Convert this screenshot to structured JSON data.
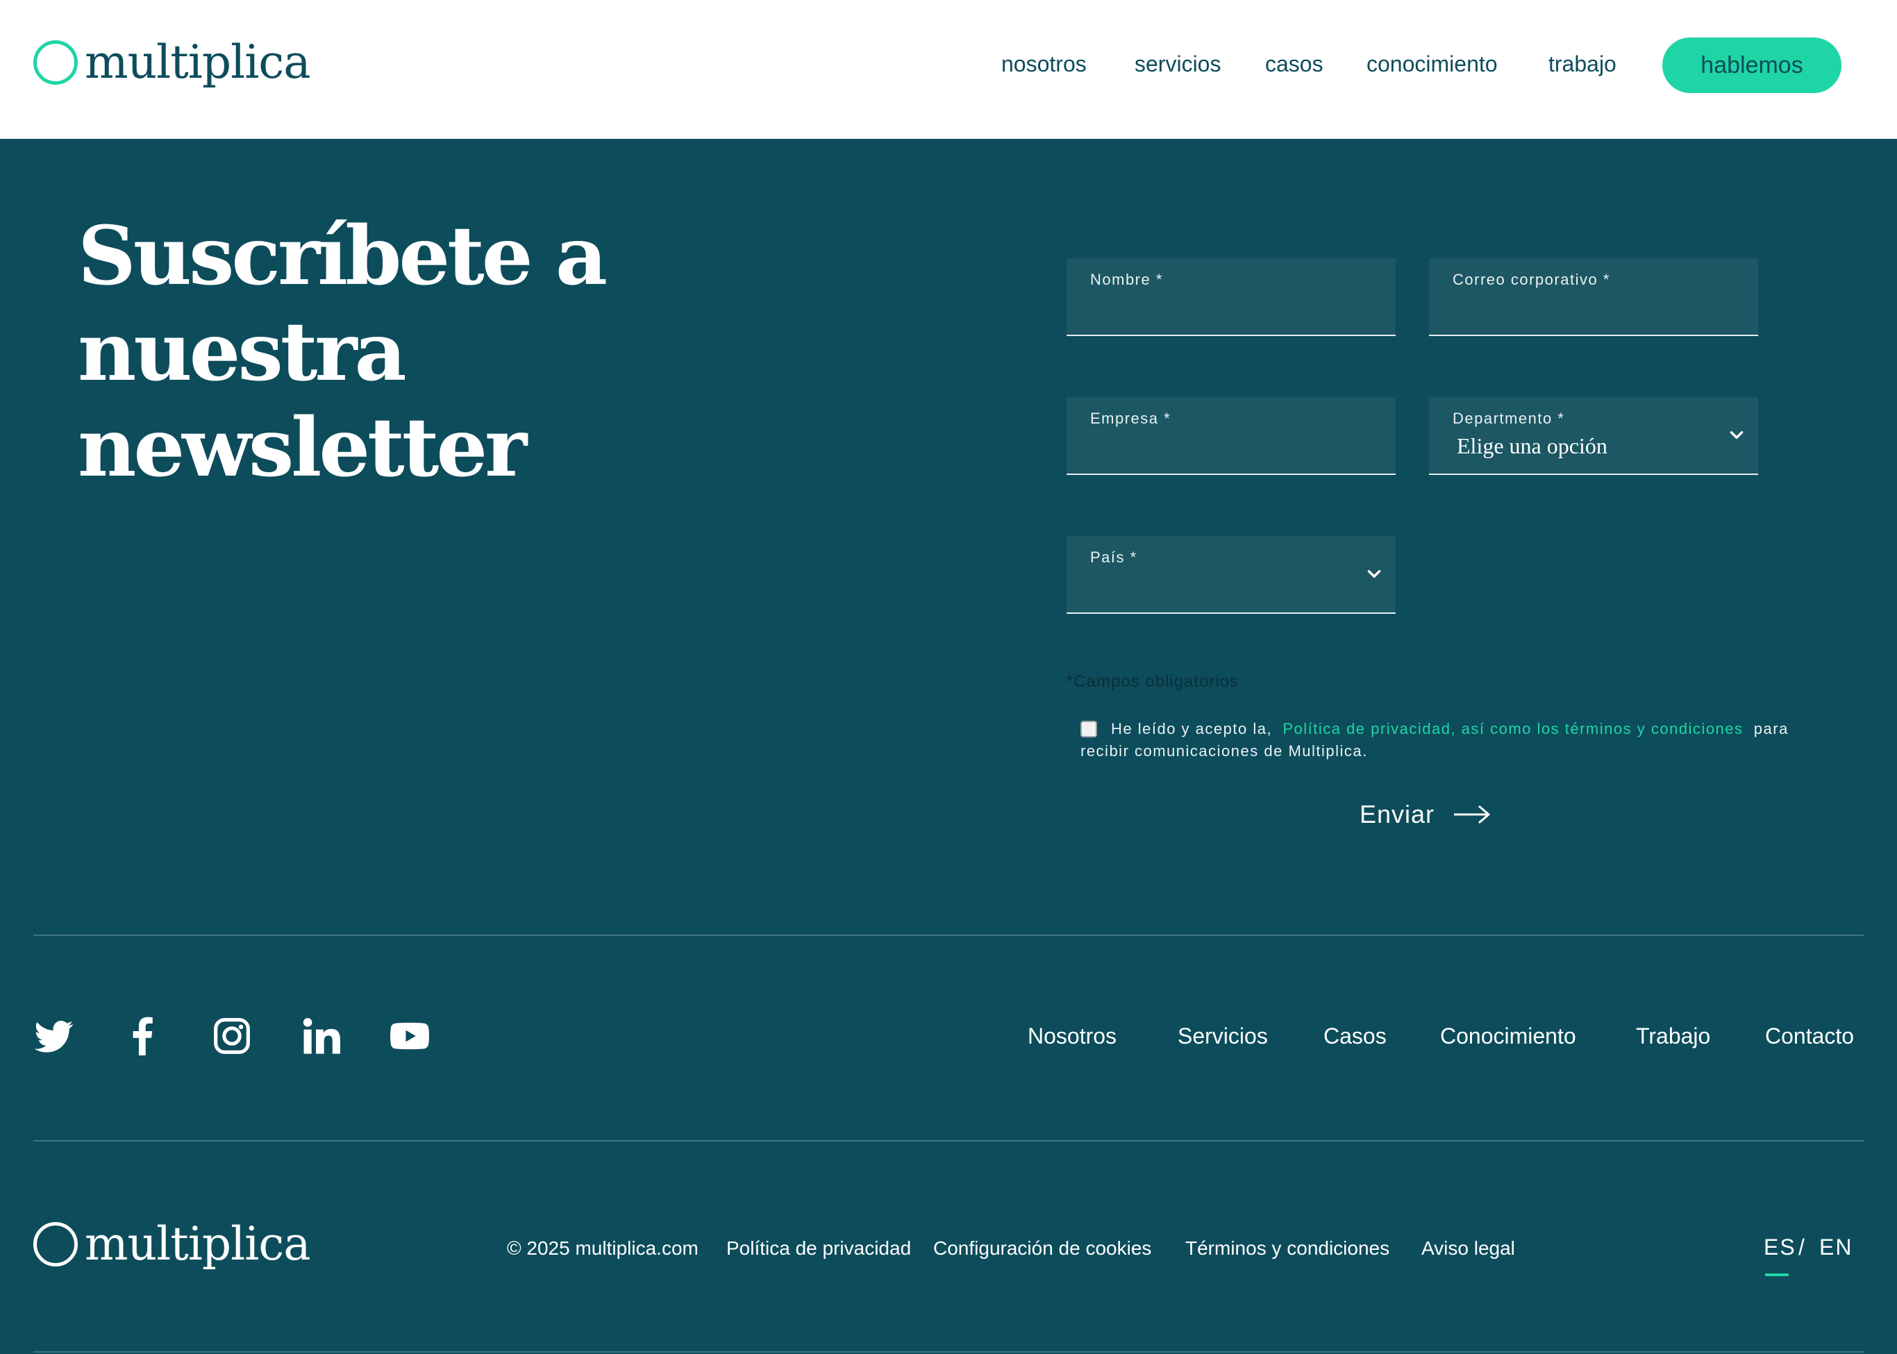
{
  "brand": {
    "name": "multiplica",
    "accent_color": "#1fd5a5",
    "primary_color": "#0d4c5b"
  },
  "header": {
    "nav": [
      "nosotros",
      "servicios",
      "casos",
      "conocimiento",
      "trabajo"
    ],
    "cta_label": "hablemos"
  },
  "newsletter": {
    "title_line1": "Suscríbete a",
    "title_line2": "nuestra newsletter",
    "fields": {
      "name": {
        "label": "Nombre *",
        "value": ""
      },
      "email": {
        "label": "Correo corporativo *",
        "value": ""
      },
      "company": {
        "label": "Empresa *",
        "value": ""
      },
      "department": {
        "label": "Departmento *",
        "value": "Elige una opción"
      },
      "country": {
        "label": "País *",
        "value": ""
      }
    },
    "required_note": "*Campos obligatorios",
    "consent_prefix": "He leído y acepto la,",
    "consent_link": "Política de privacidad, así como los términos y condiciones",
    "consent_suffix": "para recibir comunicaciones de Multiplica.",
    "consent_checked": false,
    "submit_label": "Enviar"
  },
  "footer": {
    "social_icons": [
      "twitter-icon",
      "facebook-icon",
      "instagram-icon",
      "linkedin-icon",
      "youtube-icon"
    ],
    "nav": [
      "Nosotros",
      "Servicios",
      "Casos",
      "Conocimiento",
      "Trabajo",
      "Contacto"
    ],
    "copyright": "© 2025 multiplica.com",
    "legal_links": [
      "Política de privacidad",
      "Configuración de cookies",
      "Términos y condiciones",
      "Aviso legal"
    ],
    "languages": [
      "ES",
      "EN"
    ],
    "language_separator": "/",
    "active_language": "ES"
  }
}
